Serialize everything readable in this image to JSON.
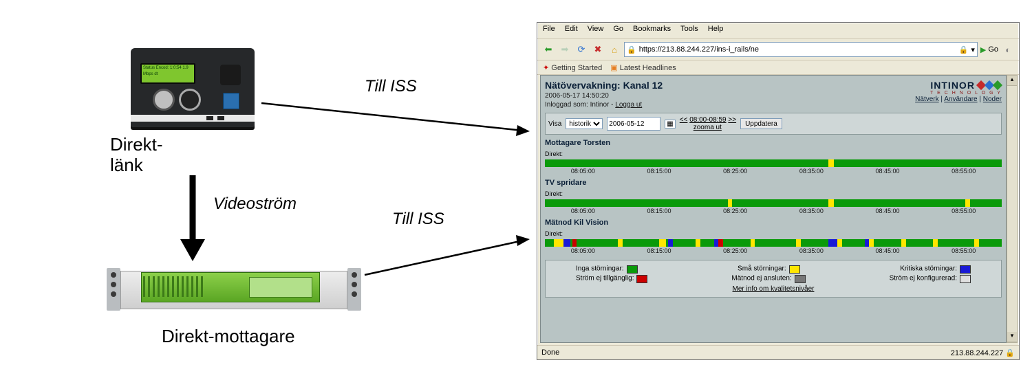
{
  "labels": {
    "direkt_lank": "Direkt-\nlänk",
    "videostrom": "Videoström",
    "till_iss_1": "Till ISS",
    "till_iss_2": "Till ISS",
    "direkt_mottagare": "Direkt-mottagare"
  },
  "encoder_lcd": "Status\nEncod: 1:0:54\n1.9 Mbps dt",
  "browser": {
    "menu": {
      "file": "File",
      "edit": "Edit",
      "view": "View",
      "go": "Go",
      "bookmarks": "Bookmarks",
      "tools": "Tools",
      "help": "Help"
    },
    "url": "https://213.88.244.227/ins-i_rails/ne",
    "go": "Go",
    "bookmarks_bar": {
      "getting_started": "Getting Started",
      "latest_headlines": "Latest Headlines"
    },
    "status_left": "Done",
    "status_right": "213.88.244.227"
  },
  "page": {
    "title": "Nätövervakning: Kanal 12",
    "timestamp": "2006-05-17 14:50:20",
    "logged_in_prefix": "Inloggad som: Intinor - ",
    "logout": "Logga ut",
    "nav": {
      "natverk": "Nätverk",
      "anvandare": "Användare",
      "noder": "Noder"
    },
    "logo": {
      "brand": "INTINOR",
      "sub": "T E C H N O L O G Y"
    },
    "controls": {
      "visa": "Visa",
      "select": "historik",
      "date": "2006-05-12",
      "range": "08:00-08:59",
      "zooma": "zooma ut",
      "uppdatera": "Uppdatera"
    },
    "timeline_ticks": [
      "08:05:00",
      "08:15:00",
      "08:25:00",
      "08:35:00",
      "08:45:00",
      "08:55:00"
    ],
    "sections": [
      {
        "title": "Mottagare Torsten",
        "prefix": "Direkt:"
      },
      {
        "title": "TV spridare",
        "prefix": "Direkt:"
      },
      {
        "title": "Mätnod Kil Vision",
        "prefix": "Direkt:"
      }
    ],
    "legend": {
      "items": [
        {
          "label": "Inga störningar:",
          "color": "#0a9a0a"
        },
        {
          "label": "Små störningar:",
          "color": "#ffe600"
        },
        {
          "label": "Kritiska störningar:",
          "color": "#1a1ad6"
        },
        {
          "label": "Ström ej tillgänglig:",
          "color": "#cc0000"
        },
        {
          "label": "Mätnod ej ansluten:",
          "color": "#777777"
        },
        {
          "label": "Ström ej konfigurerad:",
          "color": "#e0e0e0"
        }
      ],
      "more": "Mer info om kvalitetsnivåer"
    }
  }
}
